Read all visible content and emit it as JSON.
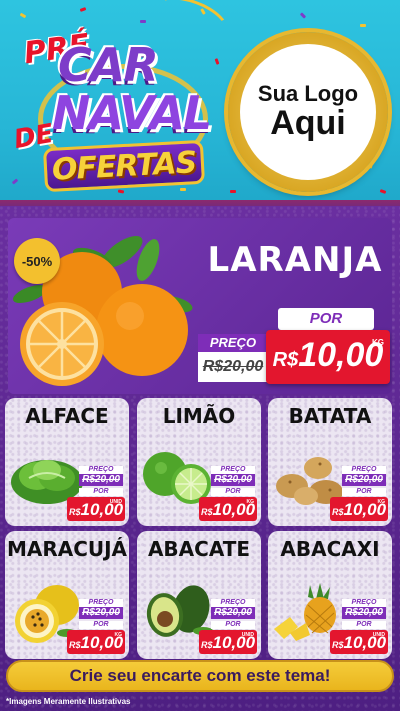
{
  "header": {
    "title_parts": {
      "pre": "PRÉ",
      "car": "CAR",
      "naval": "NAVAL",
      "de": "DE",
      "ofertas": "OFERTAS"
    },
    "logo_placeholder": {
      "line1": "Sua Logo",
      "line2": "Aqui"
    }
  },
  "featured": {
    "discount": "-50%",
    "name": "LARANJA",
    "preco_label": "PREÇO",
    "old_price": "R$20,00",
    "por_label": "POR",
    "currency": "R$",
    "new_price": "10,00",
    "unit": "KG"
  },
  "products": [
    {
      "name": "ALFACE",
      "icon": "lettuce-icon",
      "preco_label": "PREÇO",
      "old_price": "R$20,00",
      "por_label": "POR",
      "currency": "R$",
      "new_price": "10,00",
      "unit": "UNID"
    },
    {
      "name": "LIMÃO",
      "icon": "lime-icon",
      "preco_label": "PREÇO",
      "old_price": "R$20,00",
      "por_label": "POR",
      "currency": "R$",
      "new_price": "10,00",
      "unit": "KG"
    },
    {
      "name": "BATATA",
      "icon": "potato-icon",
      "preco_label": "PREÇO",
      "old_price": "R$20,00",
      "por_label": "POR",
      "currency": "R$",
      "new_price": "10,00",
      "unit": "KG"
    },
    {
      "name": "MARACUJÁ",
      "icon": "passion-fruit-icon",
      "preco_label": "PREÇO",
      "old_price": "R$20,00",
      "por_label": "POR",
      "currency": "R$",
      "new_price": "10,00",
      "unit": "KG"
    },
    {
      "name": "ABACATE",
      "icon": "avocado-icon",
      "preco_label": "PREÇO",
      "old_price": "R$20,00",
      "por_label": "POR",
      "currency": "R$",
      "new_price": "10,00",
      "unit": "UNID"
    },
    {
      "name": "ABACAXI",
      "icon": "pineapple-icon",
      "preco_label": "PREÇO",
      "old_price": "R$20,00",
      "por_label": "POR",
      "currency": "R$",
      "new_price": "10,00",
      "unit": "UNID"
    }
  ],
  "cta": "Crie seu encarte com este tema!",
  "disclaimer": "*Imagens Meramente Ilustrativas",
  "colors": {
    "header_bg": "#2ec4e0",
    "body_bg": "#5a2a8a",
    "price_red": "#e3162e",
    "accent_purple": "#7e2db8",
    "badge_yellow": "#f3c02e"
  }
}
